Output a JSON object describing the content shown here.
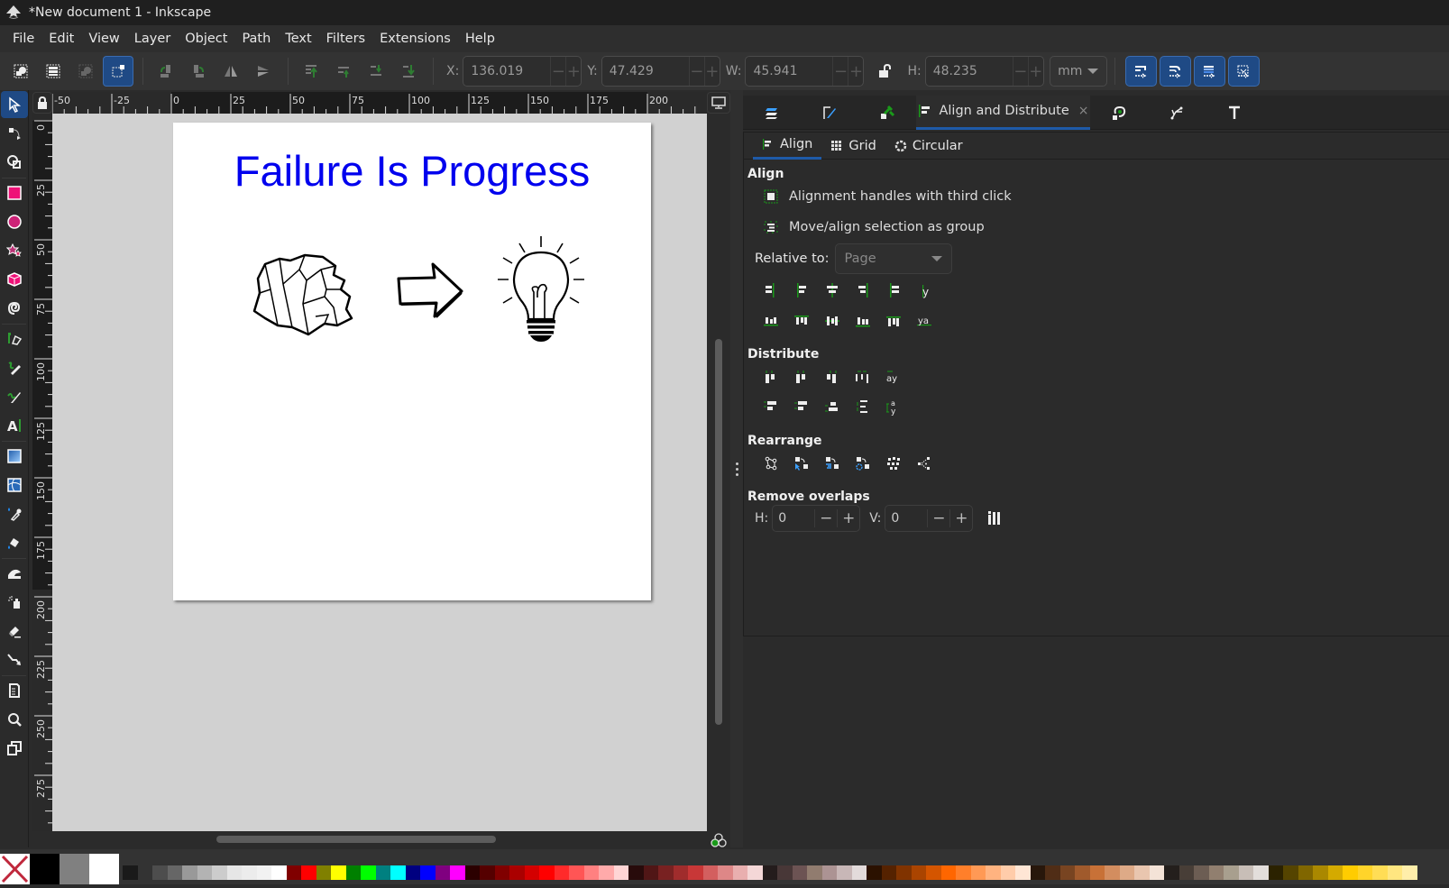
{
  "window": {
    "title": "*New document 1 - Inkscape"
  },
  "menu": [
    "File",
    "Edit",
    "View",
    "Layer",
    "Object",
    "Path",
    "Text",
    "Filters",
    "Extensions",
    "Help"
  ],
  "toolbar": {
    "x_label": "X:",
    "x_value": "136.019",
    "y_label": "Y:",
    "y_value": "47.429",
    "w_label": "W:",
    "w_value": "45.941",
    "h_label": "H:",
    "h_value": "48.235",
    "unit": "mm",
    "minus": "−",
    "plus": "+"
  },
  "rulers": {
    "top": [
      "-50",
      "-25",
      "0",
      "25",
      "50",
      "75",
      "100",
      "125",
      "150",
      "175",
      "200"
    ],
    "left": [
      "0",
      "25",
      "50",
      "75",
      "100",
      "125",
      "150",
      "175",
      "200",
      "225",
      "250",
      "275"
    ]
  },
  "canvas": {
    "title_text": "Failure Is Progress",
    "title_color": "#0000ee"
  },
  "dock": {
    "active_tab": "Align and Distribute",
    "close": "×",
    "subtabs": [
      "Align",
      "Grid",
      "Circular"
    ],
    "align": {
      "heading": "Align",
      "option1": "Alignment handles with third click",
      "option2": "Move/align selection as group",
      "relative_label": "Relative to:",
      "relative_value": "Page"
    },
    "distribute": {
      "heading": "Distribute"
    },
    "rearrange": {
      "heading": "Rearrange"
    },
    "overlaps": {
      "heading": "Remove overlaps",
      "h_label": "H:",
      "h_value": "0",
      "v_label": "V:",
      "v_value": "0"
    }
  },
  "palette": {
    "swatches": [
      "#1a1a1a",
      "#333333",
      "#4d4d4d",
      "#666666",
      "#999999",
      "#b3b3b3",
      "#cccccc",
      "#e6e6e6",
      "#ececec",
      "#f2f2f2",
      "#ffffff",
      "#800000",
      "#ff0000",
      "#808000",
      "#ffff00",
      "#008000",
      "#00ff00",
      "#008080",
      "#00ffff",
      "#000080",
      "#0000ff",
      "#800080",
      "#ff00ff",
      "#2b0000",
      "#550000",
      "#800000",
      "#aa0000",
      "#d40000",
      "#ff0000",
      "#ff2a2a",
      "#ff5555",
      "#ff8080",
      "#ffaaaa",
      "#ffd5d5",
      "#280b0b",
      "#501616",
      "#782121",
      "#a02c2c",
      "#c83737",
      "#d35f5f",
      "#de8787",
      "#e9afaf",
      "#f4d7d7",
      "#241c1c",
      "#483737",
      "#6c5353",
      "#917c6f",
      "#ac9393",
      "#c8b7b7",
      "#e3dbdb",
      "#2b1100",
      "#552200",
      "#803300",
      "#aa4400",
      "#d45500",
      "#ff6600",
      "#ff7f2a",
      "#ff9955",
      "#ffb380",
      "#ffccaa",
      "#ffe6d5",
      "#28170b",
      "#502d16",
      "#784421",
      "#a05a2c",
      "#c87137",
      "#d38d5f",
      "#deaa87",
      "#e9c6af",
      "#f4e3d7",
      "#241f1c",
      "#483e37",
      "#6c5d53",
      "#917f6f",
      "#a89f8e",
      "#c8beb7",
      "#e3dedb",
      "#2b2200",
      "#554400",
      "#806600",
      "#aa8800",
      "#d4aa00",
      "#ffcc00",
      "#ffd42a",
      "#ffdd55",
      "#ffe680",
      "#ffeeaa"
    ]
  }
}
